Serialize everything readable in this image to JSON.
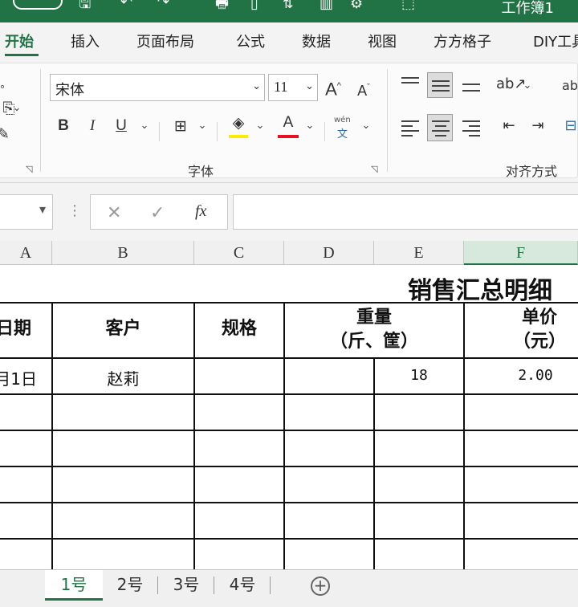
{
  "title_bar": {
    "title": "工作簿1"
  },
  "ribbon_tabs": [
    "开始",
    "插入",
    "页面布局",
    "公式",
    "数据",
    "视图",
    "方方格子",
    "DIY工具箱"
  ],
  "font_group": {
    "font_name": "宋体",
    "font_size": "11",
    "label": "字体",
    "grow_label": "A",
    "shrink_label": "A",
    "bold": "B",
    "italic": "I",
    "underline": "U",
    "font_color_label": "A",
    "phonetic_top": "wén",
    "phonetic_bottom": "文",
    "fill_color": "#ffeb00",
    "font_color": "#e81123"
  },
  "alignment_group": {
    "label": "对齐方式"
  },
  "formula_bar": {
    "fx": "fx",
    "cancel": "✕",
    "confirm": "✓",
    "name_box_arrow": "▾",
    "more": "⋮"
  },
  "columns": [
    "A",
    "B",
    "C",
    "D",
    "E",
    "F"
  ],
  "sheet": {
    "title": "销售汇总明细",
    "headers": {
      "date": "日期",
      "customer": "客户",
      "spec": "规格",
      "weight_line1": "重量",
      "weight_line2": "（斤、筐）",
      "price_line1": "单价",
      "price_line2": "（元）"
    },
    "row1": {
      "date": "月1日",
      "customer": "赵莉",
      "weight": "18",
      "price": "2.00"
    }
  },
  "sheet_tabs": [
    "1号",
    "2号",
    "3号",
    "4号"
  ],
  "add_sheet": "+"
}
